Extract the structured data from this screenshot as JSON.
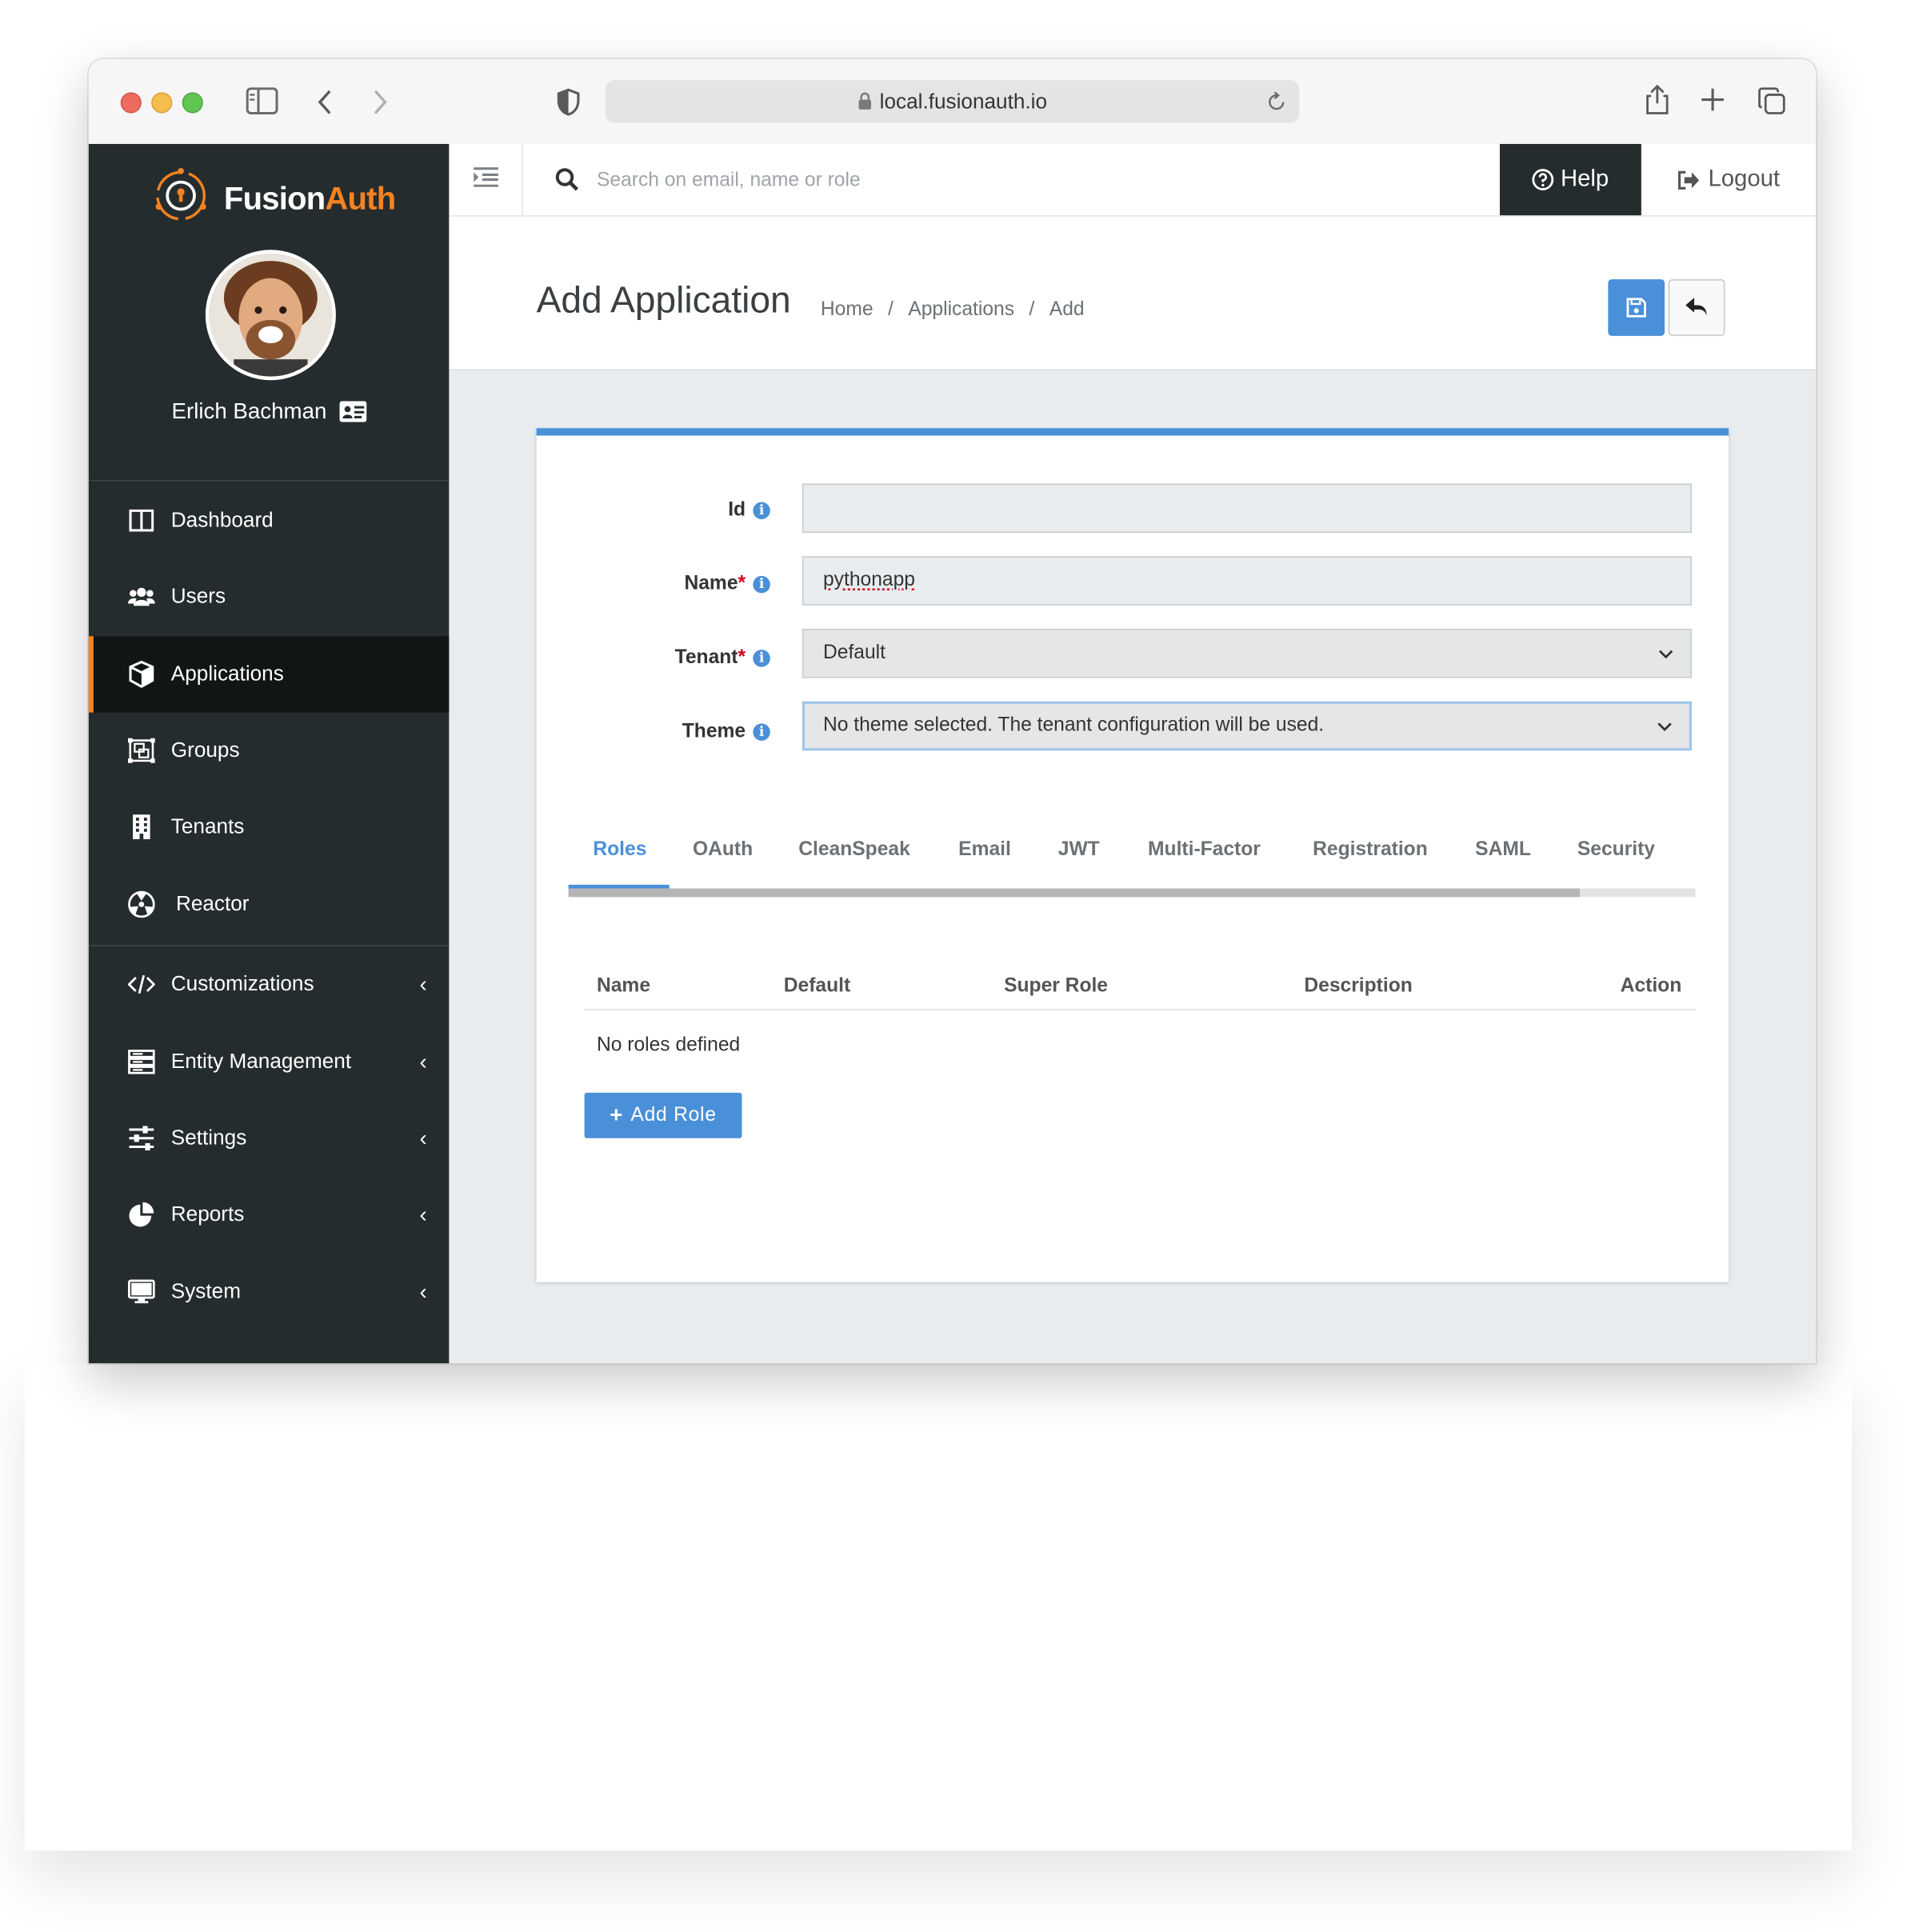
{
  "browser": {
    "url": "local.fusionauth.io"
  },
  "brand": {
    "name_part1": "Fusion",
    "name_part2": "Auth",
    "accent": "#f58320"
  },
  "user": {
    "name": "Erlich Bachman"
  },
  "sidebar": {
    "items": [
      {
        "label": "Dashboard",
        "icon": "columns-icon"
      },
      {
        "label": "Users",
        "icon": "users-icon"
      },
      {
        "label": "Applications",
        "icon": "cube-icon",
        "active": true
      },
      {
        "label": "Groups",
        "icon": "object-group-icon"
      },
      {
        "label": "Tenants",
        "icon": "building-icon"
      },
      {
        "label": "Reactor",
        "icon": "reactor-icon"
      },
      {
        "label": "Customizations",
        "icon": "code-icon",
        "expandable": true
      },
      {
        "label": "Entity Management",
        "icon": "server-icon",
        "expandable": true
      },
      {
        "label": "Settings",
        "icon": "sliders-icon",
        "expandable": true
      },
      {
        "label": "Reports",
        "icon": "pie-chart-icon",
        "expandable": true
      },
      {
        "label": "System",
        "icon": "desktop-icon",
        "expandable": true
      }
    ]
  },
  "topbar": {
    "search_placeholder": "Search on email, name or role",
    "help_label": "Help",
    "logout_label": "Logout"
  },
  "page": {
    "title": "Add Application",
    "breadcrumb": [
      "Home",
      "Applications",
      "Add"
    ]
  },
  "form": {
    "id": {
      "label": "Id",
      "value": ""
    },
    "name": {
      "label": "Name",
      "value": "pythonapp"
    },
    "tenant": {
      "label": "Tenant",
      "value": "Default"
    },
    "theme": {
      "label": "Theme",
      "value": "No theme selected. The tenant configuration will be used."
    }
  },
  "tabs": [
    "Roles",
    "OAuth",
    "CleanSpeak",
    "Email",
    "JWT",
    "Multi-Factor",
    "Registration",
    "SAML",
    "Security"
  ],
  "roles_table": {
    "columns": [
      "Name",
      "Default",
      "Super Role",
      "Description",
      "Action"
    ],
    "empty_text": "No roles defined",
    "add_button": "Add Role"
  },
  "colors": {
    "primary": "#4a90d9",
    "sidebar_bg": "#252c2e",
    "required": "#d0021b"
  }
}
